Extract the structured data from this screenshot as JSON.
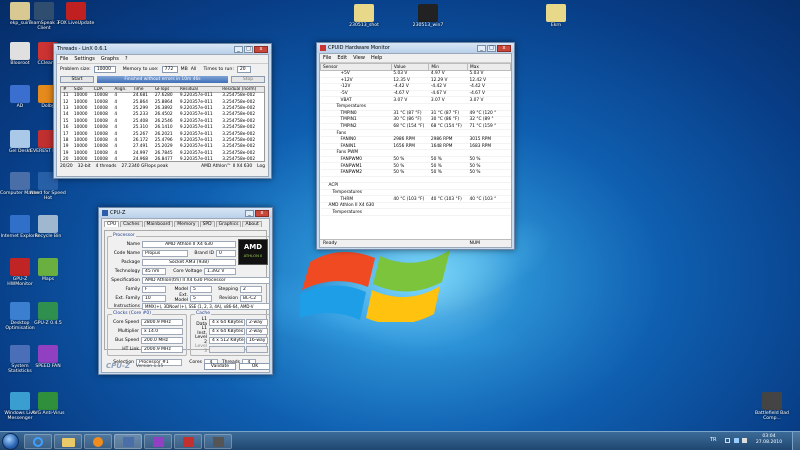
{
  "desktop": {
    "icons": [
      {
        "label": "ekp_suin",
        "color": "#d8c892"
      },
      {
        "label": "TeamSpeak 3 Client",
        "color": "#2f4d6f"
      },
      {
        "label": "FOX LiveUpdate",
        "color": "#c02020"
      },
      {
        "label": "Blooroot",
        "color": "#e0e0e0"
      },
      {
        "label": "CCleaner",
        "color": "#cc3333"
      },
      {
        "label": "AD",
        "color": "#3a6fd0"
      },
      {
        "label": "Dolby",
        "color": "#e58a1c"
      },
      {
        "label": "Gel Deskt",
        "color": "#aac8e8"
      },
      {
        "label": "EVEREST Home",
        "color": "#c03030"
      },
      {
        "label": "Computer Master",
        "color": "#4a6fa8"
      },
      {
        "label": "Need for Speed Hot",
        "color": "#2860a8"
      },
      {
        "label": "Internet Explorer",
        "color": "#3070c8"
      },
      {
        "label": "Recycle Bin",
        "color": "#9fb8d0"
      },
      {
        "label": "GPU-Z HWMonitor",
        "color": "#c02424"
      },
      {
        "label": "Maps",
        "color": "#6ab040"
      },
      {
        "label": "Desktop Optimisation",
        "color": "#3a7fd0"
      },
      {
        "label": "GPU-Z 0.4.5",
        "color": "#2f8f4f"
      },
      {
        "label": "System Statisticks",
        "color": "#4a6fb8"
      },
      {
        "label": "SPEED FAN",
        "color": "#9040c0"
      },
      {
        "label": "Windows Live Messenger",
        "color": "#3a9fd0"
      },
      {
        "label": "AVG Anti-Virus",
        "color": "#2f8f3a"
      },
      {
        "label": "230513_shot",
        "color": "#e8d88a"
      },
      {
        "label": "230513_win7",
        "color": "#222222"
      },
      {
        "label": "Ekrn",
        "color": "#e8d88a"
      },
      {
        "label": "Battlefield Bad Comp...",
        "color": "#444444"
      }
    ]
  },
  "linx": {
    "title": "Threads - LinX 0.6.1",
    "menu": [
      "File",
      "Settings",
      "Graphs",
      "?"
    ],
    "problem_label": "Problem size:",
    "problem_value": "10000",
    "memory_label": "Memory to use:",
    "memory_value": "772",
    "mb": "MB",
    "all": "All",
    "times_label": "Times to run:",
    "times_value": "20",
    "start": "Start",
    "status": "Finished without errors in 10m 46s",
    "stop": "Stop",
    "columns": [
      "#",
      "Size",
      "LDA",
      "Align.",
      "Time",
      "GFlops",
      "Residual",
      "Residual (norm)"
    ],
    "rows": [
      [
        "11",
        "10000",
        "10008",
        "4",
        "24.681",
        "27.6280",
        "9.220357e-011",
        "3.254758e-002"
      ],
      [
        "12",
        "10000",
        "10008",
        "4",
        "25.864",
        "25.8864",
        "9.220357e-011",
        "3.254758e-002"
      ],
      [
        "13",
        "10000",
        "10008",
        "4",
        "25.299",
        "26.3892",
        "9.220357e-011",
        "3.254758e-002"
      ],
      [
        "14",
        "10000",
        "10008",
        "4",
        "25.233",
        "26.4502",
        "9.220357e-011",
        "3.254758e-002"
      ],
      [
        "15",
        "10000",
        "10008",
        "4",
        "25.408",
        "26.2546",
        "9.220357e-011",
        "3.254758e-002"
      ],
      [
        "16",
        "10000",
        "10008",
        "4",
        "25.310",
        "26.1410",
        "9.220357e-011",
        "3.254758e-002"
      ],
      [
        "17",
        "10000",
        "10008",
        "4",
        "25.267",
        "26.2021",
        "9.220357e-011",
        "3.254758e-002"
      ],
      [
        "18",
        "10000",
        "10008",
        "4",
        "26.172",
        "25.4796",
        "9.220357e-011",
        "3.254758e-002"
      ],
      [
        "19",
        "10000",
        "10008",
        "4",
        "27.491",
        "25.2029",
        "9.220357e-011",
        "3.254758e-002"
      ],
      [
        "19",
        "10000",
        "10008",
        "4",
        "24.997",
        "26.7845",
        "9.220357e-011",
        "3.254758e-002"
      ],
      [
        "20",
        "10000",
        "10008",
        "4",
        "24.968",
        "26.8477",
        "9.220357e-011",
        "3.254758e-002"
      ]
    ],
    "status_bar": [
      "20/20",
      "32-bit",
      "4 threads",
      "27.2340 GFlops peak",
      "AMD Athlon™ II X4 630",
      "Log"
    ]
  },
  "hwmon": {
    "title": "CPUID Hardware Monitor",
    "menu": [
      "File",
      "Edit",
      "View",
      "Help"
    ],
    "columns": [
      "Sensor",
      "Value",
      "Min",
      "Max"
    ],
    "rows": [
      {
        "t": "+5V",
        "v": "5.03 V",
        "mn": "4.97 V",
        "mx": "5.03 V",
        "l": 5
      },
      {
        "t": "+12V",
        "v": "12.35 V",
        "mn": "12.29 V",
        "mx": "12.42 V",
        "l": 5
      },
      {
        "t": "-12V",
        "v": "-4.42 V",
        "mn": "-4.42 V",
        "mx": "-4.42 V",
        "l": 5
      },
      {
        "t": "-5V",
        "v": "-4.67 V",
        "mn": "-4.67 V",
        "mx": "-4.67 V",
        "l": 5
      },
      {
        "t": "VBAT",
        "v": "3.07 V",
        "mn": "3.07 V",
        "mx": "3.07 V",
        "l": 5
      },
      {
        "t": "Temperatures",
        "v": "",
        "mn": "",
        "mx": "",
        "l": 4
      },
      {
        "t": "TMPIN0",
        "v": "31 °C (87 °F)",
        "mn": "31 °C (87 °F)",
        "mx": "49 °C (120 °",
        "l": 5
      },
      {
        "t": "TMPIN1",
        "v": "30 °C (86 °F)",
        "mn": "30 °C (86 °F)",
        "mx": "32 °C (89 °",
        "l": 5
      },
      {
        "t": "TMPIN2",
        "v": "68 °C (154 °F)",
        "mn": "68 °C (154 °F)",
        "mx": "71 °C (159 °",
        "l": 5
      },
      {
        "t": "Fans",
        "v": "",
        "mn": "",
        "mx": "",
        "l": 4
      },
      {
        "t": "FANIN0",
        "v": "2986 RPM",
        "mn": "2986 RPM",
        "mx": "3015 RPM",
        "l": 5
      },
      {
        "t": "FANIN1",
        "v": "1656 RPM",
        "mn": "1648 RPM",
        "mx": "1683 RPM",
        "l": 5
      },
      {
        "t": "Fans PWM",
        "v": "",
        "mn": "",
        "mx": "",
        "l": 4
      },
      {
        "t": "FANPWM0",
        "v": "50 %",
        "mn": "50 %",
        "mx": "50 %",
        "l": 5
      },
      {
        "t": "FANPWM1",
        "v": "50 %",
        "mn": "50 %",
        "mx": "50 %",
        "l": 5
      },
      {
        "t": "FANPWM2",
        "v": "50 %",
        "mn": "50 %",
        "mx": "50 %",
        "l": 5
      },
      {
        "t": "",
        "v": "",
        "mn": "",
        "mx": "",
        "l": 0
      },
      {
        "t": "ACPI",
        "v": "",
        "mn": "",
        "mx": "",
        "l": 2
      },
      {
        "t": "Temperatures",
        "v": "",
        "mn": "",
        "mx": "",
        "l": 3
      },
      {
        "t": "THRM",
        "v": "40 °C (103 °F)",
        "mn": "40 °C (103 °F)",
        "mx": "40 °C (103 °",
        "l": 5
      },
      {
        "t": "AMD Athlon II X4 630",
        "v": "",
        "mn": "",
        "mx": "",
        "l": 2
      },
      {
        "t": "Temperatures",
        "v": "",
        "mn": "",
        "mx": "",
        "l": 3
      }
    ],
    "status": "Ready",
    "num": "NUM"
  },
  "cpuz": {
    "title": "CPU-Z",
    "tabs": [
      "CPU",
      "Caches",
      "Mainboard",
      "Memory",
      "SPD",
      "Graphics",
      "About"
    ],
    "processor": "Processor",
    "name_l": "Name",
    "name_v": "AMD Athlon II X4 630",
    "codename_l": "Code Name",
    "codename_v": "Propus",
    "brand_l": "Brand ID",
    "brand_v": "0",
    "package_l": "Package",
    "package_v": "Socket AM3 (938)",
    "tech_l": "Technology",
    "tech_v": "45 nm",
    "cv_l": "Core Voltage",
    "cv_v": "1.392 V",
    "spec_l": "Specification",
    "spec_v": "AMD Athlon(tm) II X4 630 Processor",
    "family_l": "Family",
    "family_v": "F",
    "model_l": "Model",
    "model_v": "5",
    "step_l": "Stepping",
    "step_v": "2",
    "extf_l": "Ext. Family",
    "extf_v": "10",
    "extm_l": "Ext. Model",
    "extm_v": "5",
    "rev_l": "Revision",
    "rev_v": "BL-C2",
    "inst_l": "Instructions",
    "inst_v": "MMX(+), 3DNow!(+), SSE (1, 2, 3, 4A), x86-64, AMD-V",
    "clocks": "Clocks (Core #0)",
    "cache": "Cache",
    "cs_l": "Core Speed",
    "cs_v": "2800.9 MHz",
    "mul_l": "Multiplier",
    "mul_v": "x 14.0",
    "bus_l": "Bus Speed",
    "bus_v": "200.0 MHz",
    "ht_l": "HT Link",
    "ht_v": "2000.9 MHz",
    "l1d_l": "L1 Data",
    "l1d_v": "4 x 64 KBytes",
    "l1d_w": "2-way",
    "l1i_l": "L1 Inst.",
    "l1i_v": "4 x 64 KBytes",
    "l1i_w": "2-way",
    "l2_l": "Level 2",
    "l2_v": "4 x 512 KBytes",
    "l2_w": "16-way",
    "l3_l": "Level 3",
    "sel_l": "Selection",
    "sel_v": "Processor #1",
    "cores_l": "Cores",
    "cores_v": "4",
    "thr_l": "Threads",
    "thr_v": "4",
    "brand": "CPU-Z",
    "version": "Version 1.55",
    "validate": "Validate",
    "ok": "OK",
    "logo_top": "AMD",
    "logo_mid": "ATHLON II"
  },
  "taskbar": {
    "lang": "TR",
    "time": "03:04",
    "date": "27.08.2010"
  }
}
